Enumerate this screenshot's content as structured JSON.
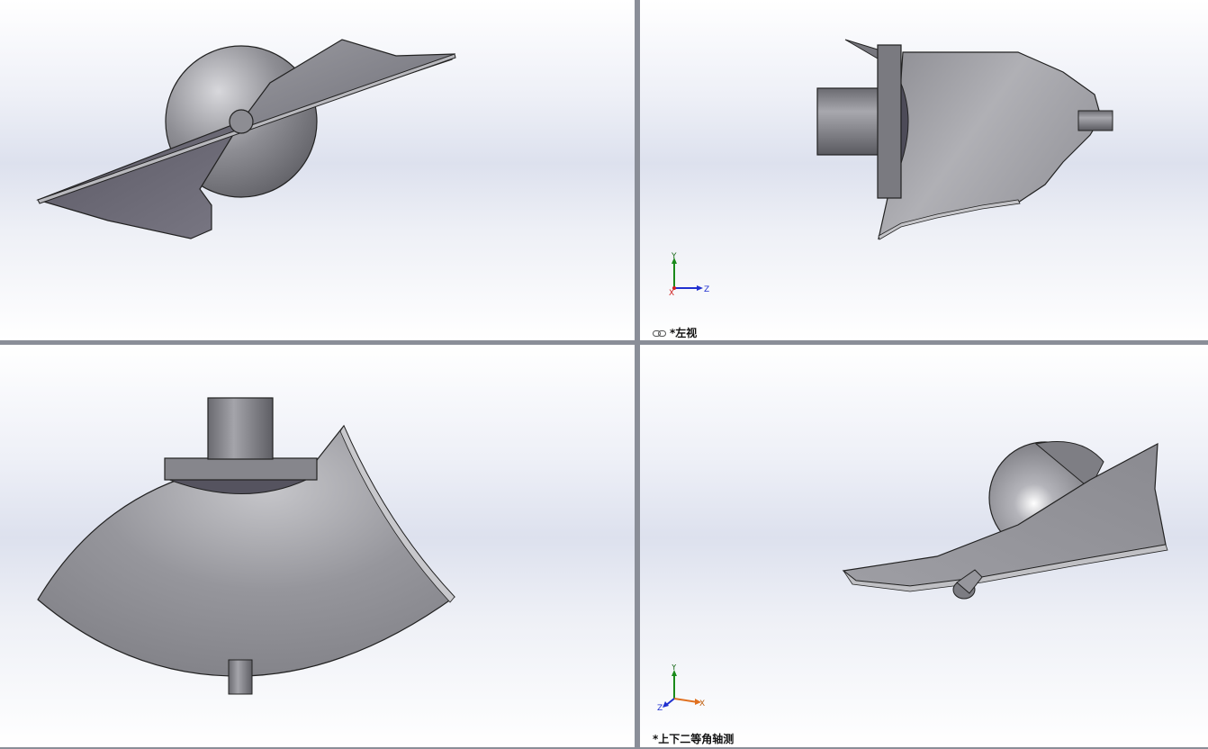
{
  "viewports": {
    "top_left": {
      "name": "front-view"
    },
    "top_right": {
      "name": "left-view",
      "label": "*左视",
      "triad": {
        "axis_up": "Y",
        "axis_right": "Z",
        "axis_origin": "X"
      }
    },
    "bottom_left": {
      "name": "top-view"
    },
    "bottom_right": {
      "name": "trimetric-view",
      "label": "*上下二等角轴测",
      "triad": {
        "axis_up": "Y",
        "axis_right": "X",
        "axis_left": "Z"
      }
    }
  },
  "icons": {
    "link": "link-icon",
    "triad": "coordinate-triad-icon"
  },
  "colors": {
    "background_top": "#ffffff",
    "background_mid": "#dde1ee",
    "splitter": "#8a8e98",
    "model_gray": "#8c8c90",
    "axis_y": "#1a8a1a",
    "axis_z_right": "#2030d0",
    "axis_x_right": "#e07020",
    "axis_x_origin": "#d02020"
  }
}
